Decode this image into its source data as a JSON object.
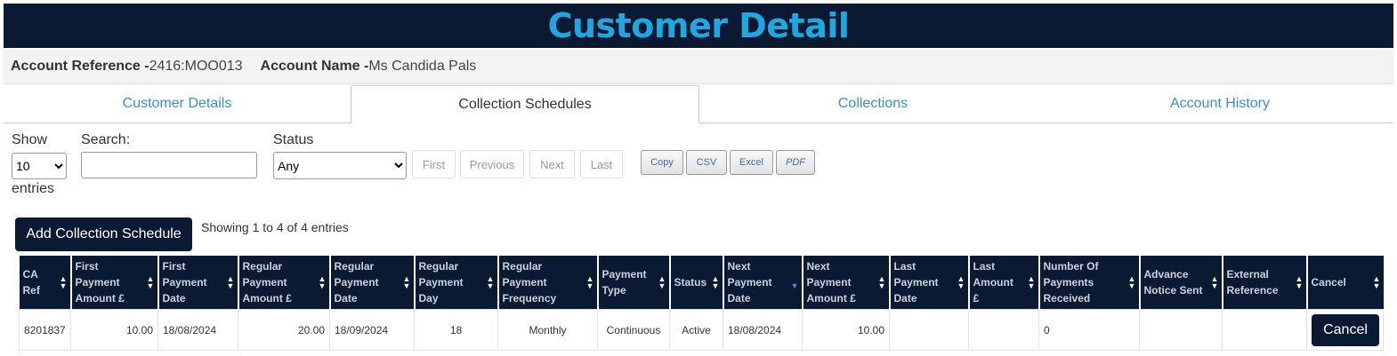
{
  "page": {
    "title": "Customer Detail"
  },
  "account": {
    "ref_label": "Account Reference - ",
    "ref_value": "2416:MOO013",
    "name_label": "Account Name - ",
    "name_value": "Ms Candida Pals"
  },
  "tabs": [
    {
      "label": "Customer Details",
      "active": false
    },
    {
      "label": "Collection Schedules",
      "active": true
    },
    {
      "label": "Collections",
      "active": false
    },
    {
      "label": "Account History",
      "active": false
    }
  ],
  "controls": {
    "show_label": "Show",
    "show_value": "10",
    "entries_label": "entries",
    "search_label": "Search:",
    "search_value": "",
    "status_label": "Status",
    "status_value": "Any",
    "pagination": {
      "first": "First",
      "previous": "Previous",
      "next": "Next",
      "last": "Last"
    },
    "export": {
      "copy": "Copy",
      "csv": "CSV",
      "excel": "Excel",
      "pdf": "PDF"
    },
    "add_button": "Add Collection Schedule",
    "info": "Showing 1 to 4 of 4 entries"
  },
  "table": {
    "columns": [
      "CA Ref",
      "First Payment Amount £",
      "First Payment Date",
      "Regular Payment Amount £",
      "Regular Payment Date",
      "Regular Payment Day",
      "Regular Payment Frequency",
      "Payment Type",
      "Status",
      "Next Payment Date",
      "Next Payment Amount £",
      "Last Payment Date",
      "Last Amount £",
      "Number Of Payments Received",
      "Advance Notice Sent",
      "External Reference",
      "Cancel"
    ],
    "rows": [
      [
        "8201837",
        "10.00",
        "18/08/2024",
        "20.00",
        "18/09/2024",
        "18",
        "Monthly",
        "Continuous",
        "Active",
        "18/08/2024",
        "10.00",
        "",
        "",
        "0",
        "",
        "",
        "Cancel"
      ]
    ],
    "sorted_column": "Next Payment Date"
  },
  "colors": {
    "navy": "#0b1a33",
    "title_blue": "#1ea7e1",
    "link_blue": "#3c8dd0"
  }
}
